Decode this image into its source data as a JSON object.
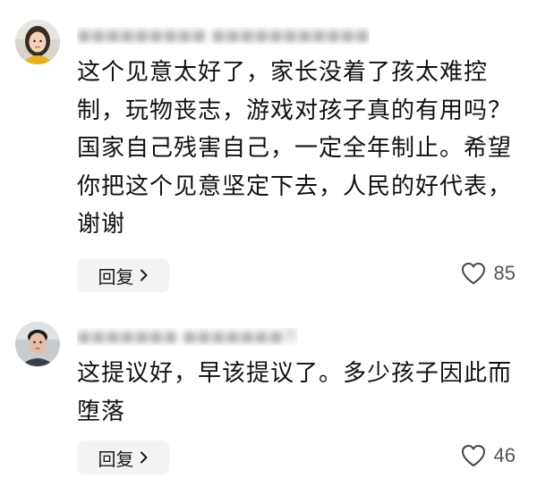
{
  "comments": [
    {
      "username": "■■■■■■■■■ ■■■■■■■■■■■",
      "text": "这个见意太好了，家长没着了孩太难控制，玩物丧志，游戏对孩子真的有用吗？国家自己残害自己，一定全年制止。希望你把这个见意坚定下去，人民的好代表，谢谢",
      "reply_label": "回复",
      "like_count": "85",
      "avatar_icon": "avatar-woman-icon",
      "like_icon": "heart-outline-icon",
      "reply_icon": "chevron-right-icon"
    },
    {
      "username": "■■■■■■■ ■■■■■■■苏",
      "text": "这提议好，早该提议了。多少孩子因此而堕落",
      "reply_label": "回复",
      "like_count": "46",
      "avatar_icon": "avatar-man-icon",
      "like_icon": "heart-outline-icon",
      "reply_icon": "chevron-right-icon"
    }
  ],
  "colors": {
    "text": "#111111",
    "muted": "#9b9b9b",
    "reply_bg": "#f3f3f3",
    "like_text": "#555555"
  }
}
